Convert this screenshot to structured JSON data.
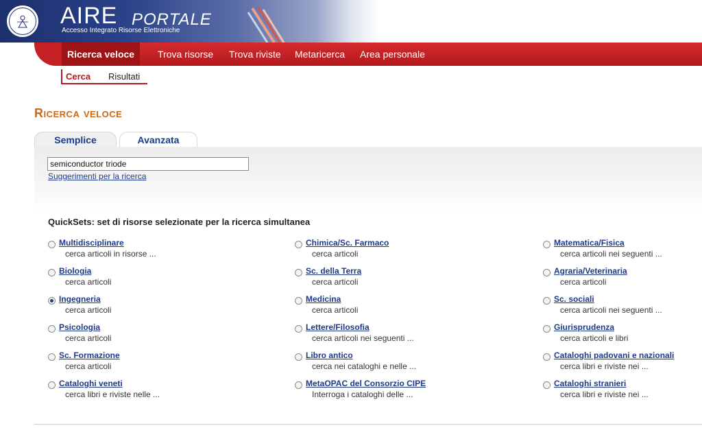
{
  "banner": {
    "logo_main": "AIRE",
    "logo_secondary": "PORTALE",
    "logo_subtitle": "Accesso Integrato Risorse Elettroniche",
    "seal_icon": "university-seal-icon"
  },
  "nav": {
    "items": [
      {
        "label": "Ricerca veloce",
        "active": true
      },
      {
        "label": "Trova risorse",
        "active": false
      },
      {
        "label": "Trova riviste",
        "active": false
      },
      {
        "label": "Metaricerca",
        "active": false
      },
      {
        "label": "Area personale",
        "active": false
      }
    ]
  },
  "subnav": {
    "items": [
      {
        "label": "Cerca",
        "active": true
      },
      {
        "label": "Risultati",
        "active": false
      }
    ]
  },
  "page": {
    "title": "Ricerca veloce"
  },
  "tabs": [
    {
      "label": "Semplice",
      "selected": true
    },
    {
      "label": "Avanzata",
      "selected": false
    }
  ],
  "search": {
    "value": "semiconductor triode",
    "hint_link": "Suggerimenti per la ricerca"
  },
  "quicksets": {
    "title": "QuickSets: set di risorse selezionate per la ricerca simultanea",
    "columns": [
      [
        {
          "name": "Multidisciplinare",
          "desc": "cerca articoli in risorse ...",
          "checked": false
        },
        {
          "name": "Biologia",
          "desc": "cerca articoli",
          "checked": false
        },
        {
          "name": "Ingegneria",
          "desc": "cerca articoli",
          "checked": true
        },
        {
          "name": "Psicologia",
          "desc": "cerca articoli",
          "checked": false
        },
        {
          "name": "Sc. Formazione",
          "desc": "cerca articoli",
          "checked": false
        },
        {
          "name": "Cataloghi veneti",
          "desc": "cerca libri e riviste nelle ...",
          "checked": false
        }
      ],
      [
        {
          "name": "Chimica/Sc. Farmaco",
          "desc": "cerca articoli",
          "checked": false
        },
        {
          "name": "Sc. della Terra",
          "desc": "cerca articoli",
          "checked": false
        },
        {
          "name": "Medicina",
          "desc": "cerca articoli",
          "checked": false
        },
        {
          "name": "Lettere/Filosofia",
          "desc": "cerca articoli nei seguenti ...",
          "checked": false
        },
        {
          "name": "Libro antico",
          "desc": "cerca nei cataloghi e nelle ...",
          "checked": false
        },
        {
          "name": "MetaOPAC del Consorzio CIPE",
          "desc": "Interroga i cataloghi delle ...",
          "checked": false
        }
      ],
      [
        {
          "name": "Matematica/Fisica",
          "desc": "cerca articoli nei seguenti ...",
          "checked": false
        },
        {
          "name": "Agraria/Veterinaria",
          "desc": "cerca articoli",
          "checked": false
        },
        {
          "name": "Sc. sociali",
          "desc": "cerca articoli nei seguenti ...",
          "checked": false
        },
        {
          "name": "Giurisprudenza",
          "desc": "cerca articoli e libri",
          "checked": false
        },
        {
          "name": "Cataloghi padovani e nazionali",
          "desc": "cerca libri e riviste nei ...",
          "checked": false
        },
        {
          "name": "Cataloghi stranieri",
          "desc": "cerca libri e riviste nei ...",
          "checked": false
        }
      ]
    ]
  },
  "colors": {
    "nav_red": "#c52124",
    "nav_active": "#9e1416",
    "title_orange": "#c96a14",
    "link_blue": "#1d3a8a",
    "banner_blue": "#1c2f6e"
  }
}
